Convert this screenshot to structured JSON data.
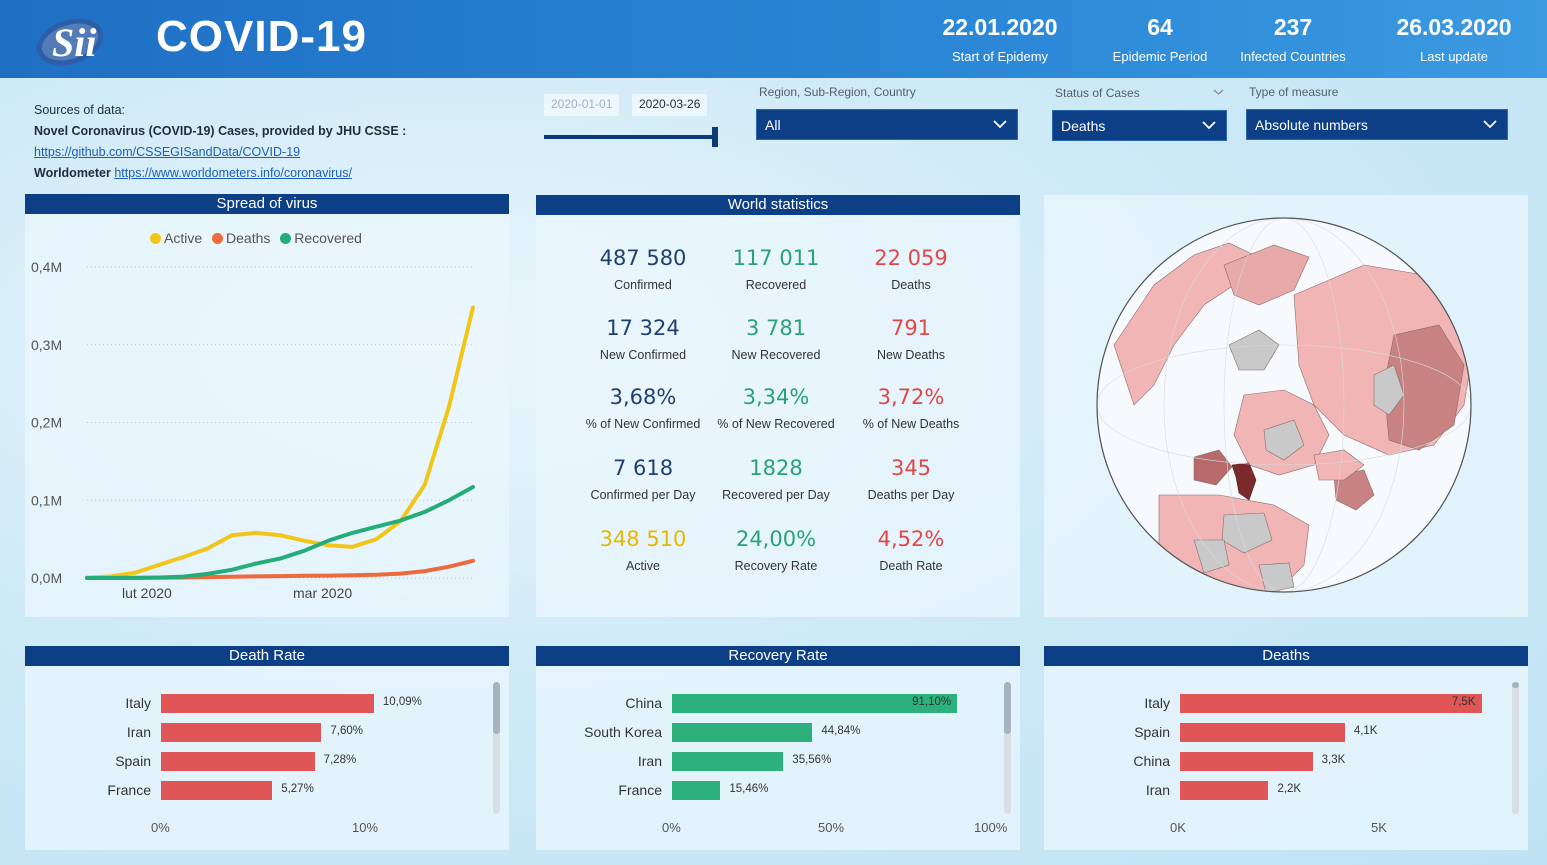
{
  "header": {
    "title": "COVID-19",
    "kpis": [
      {
        "value": "22.01.2020",
        "label": "Start of Epidemy"
      },
      {
        "value": "64",
        "label": "Epidemic Period"
      },
      {
        "value": "237",
        "label": "Infected Countries"
      },
      {
        "value": "26.03.2020",
        "label": "Last update"
      }
    ]
  },
  "sources": {
    "heading": "Sources of data:",
    "line1": "Novel Coronavirus (COVID-19) Cases, provided by JHU CSSE :",
    "link1": "https://github.com/CSSEGISandData/COVID-19",
    "wm_label": "Worldometer",
    "link2": "https://www.worldometers.info/coronavirus/"
  },
  "date_slicer": {
    "from": "2020-01-01",
    "to": "2020-03-26",
    "fill_fraction": 1.0
  },
  "filters": {
    "region": {
      "label": "Region, Sub-Region, Country",
      "value": "All"
    },
    "status": {
      "label": "Status of Cases",
      "value": "Deaths"
    },
    "measure": {
      "label": "Type of measure",
      "value": "Absolute numbers"
    }
  },
  "spread": {
    "title": "Spread of virus",
    "legend": [
      {
        "name": "Active",
        "color": "#f2c618"
      },
      {
        "name": "Deaths",
        "color": "#ec6a3c"
      },
      {
        "name": "Recovered",
        "color": "#25ad79"
      }
    ],
    "y_ticks": [
      "0,4M",
      "0,3M",
      "0,2M",
      "0,1M",
      "0,0M"
    ],
    "x_ticks": [
      "lut 2020",
      "mar 2020"
    ]
  },
  "world": {
    "title": "World statistics",
    "stats": [
      {
        "value": "487 580",
        "label": "Confirmed",
        "color": "blue"
      },
      {
        "value": "117 011",
        "label": "Recovered",
        "color": "green"
      },
      {
        "value": "22 059",
        "label": "Deaths",
        "color": "red"
      },
      {
        "value": "17 324",
        "label": "New Confirmed",
        "color": "blue"
      },
      {
        "value": "3 781",
        "label": "New Recovered",
        "color": "green"
      },
      {
        "value": "791",
        "label": "New Deaths",
        "color": "red"
      },
      {
        "value": "3,68%",
        "label": "% of New Confirmed",
        "color": "blue"
      },
      {
        "value": "3,34%",
        "label": "% of New Recovered",
        "color": "green"
      },
      {
        "value": "3,72%",
        "label": "% of New Deaths",
        "color": "red"
      },
      {
        "value": "7 618",
        "label": "Confirmed per Day",
        "color": "blue"
      },
      {
        "value": "1828",
        "label": "Recovered per Day",
        "color": "green"
      },
      {
        "value": "345",
        "label": "Deaths per Day",
        "color": "red"
      },
      {
        "value": "348 510",
        "label": "Active",
        "color": "yellow"
      },
      {
        "value": "24,00%",
        "label": "Recovery Rate",
        "color": "green"
      },
      {
        "value": "4,52%",
        "label": "Death Rate",
        "color": "red"
      }
    ]
  },
  "death_rate": {
    "title": "Death Rate",
    "color": "#e05555",
    "axis": [
      "0%",
      "10%"
    ],
    "max": 10,
    "rows": [
      {
        "label": "Italy",
        "value": 10.09,
        "text": "10,09%"
      },
      {
        "label": "Iran",
        "value": 7.6,
        "text": "7,60%"
      },
      {
        "label": "Spain",
        "value": 7.28,
        "text": "7,28%"
      },
      {
        "label": "France",
        "value": 5.27,
        "text": "5,27%"
      }
    ]
  },
  "recovery_rate": {
    "title": "Recovery Rate",
    "color": "#2cb07c",
    "axis": [
      "0%",
      "50%",
      "100%"
    ],
    "max": 100,
    "rows": [
      {
        "label": "China",
        "value": 91.1,
        "text": "91,10%"
      },
      {
        "label": "South Korea",
        "value": 44.84,
        "text": "44,84%"
      },
      {
        "label": "Iran",
        "value": 35.56,
        "text": "35,56%"
      },
      {
        "label": "France",
        "value": 15.46,
        "text": "15,46%"
      }
    ]
  },
  "deaths": {
    "title": "Deaths",
    "color": "#e05555",
    "axis": [
      "0K",
      "5K"
    ],
    "max": 5,
    "rows": [
      {
        "label": "Italy",
        "value": 7.5,
        "text": "7,5K"
      },
      {
        "label": "Spain",
        "value": 4.1,
        "text": "4,1K"
      },
      {
        "label": "China",
        "value": 3.3,
        "text": "3,3K"
      },
      {
        "label": "Iran",
        "value": 2.2,
        "text": "2,2K"
      }
    ]
  },
  "chart_data": {
    "type": "line",
    "xlabel": "",
    "ylabel": "",
    "ylim": [
      0,
      0.4
    ],
    "x_ticks": [
      "lut 2020",
      "mar 2020"
    ],
    "y_ticks": [
      "0,4M",
      "0,3M",
      "0,2M",
      "0,1M",
      "0,0M"
    ],
    "legend_position": "top",
    "x": [
      "2020-01-22",
      "2020-01-26",
      "2020-01-30",
      "2020-02-03",
      "2020-02-07",
      "2020-02-11",
      "2020-02-15",
      "2020-02-19",
      "2020-02-23",
      "2020-02-27",
      "2020-03-02",
      "2020-03-06",
      "2020-03-10",
      "2020-03-14",
      "2020-03-18",
      "2020-03-22",
      "2020-03-26"
    ],
    "series": [
      {
        "name": "Active",
        "color": "#f2c618",
        "values": [
          0.0005,
          0.002,
          0.007,
          0.017,
          0.027,
          0.038,
          0.055,
          0.058,
          0.055,
          0.048,
          0.042,
          0.04,
          0.05,
          0.073,
          0.12,
          0.22,
          0.348
        ]
      },
      {
        "name": "Deaths",
        "color": "#ec6a3c",
        "values": [
          2e-05,
          6e-05,
          0.0002,
          0.0004,
          0.0007,
          0.0011,
          0.0017,
          0.0021,
          0.0025,
          0.0028,
          0.0031,
          0.0035,
          0.0043,
          0.0057,
          0.0089,
          0.0145,
          0.0221
        ]
      },
      {
        "name": "Recovered",
        "color": "#25ad79",
        "values": [
          3e-05,
          4e-05,
          0.00014,
          0.0006,
          0.0018,
          0.0053,
          0.0105,
          0.0185,
          0.025,
          0.035,
          0.048,
          0.058,
          0.066,
          0.074,
          0.085,
          0.1,
          0.117
        ]
      }
    ]
  }
}
